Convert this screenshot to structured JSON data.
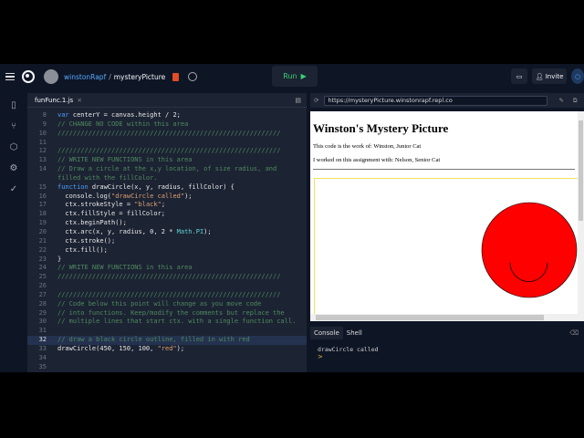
{
  "topbar": {
    "user": "winstonRapf",
    "separator": "/",
    "repl": "mysteryPicture",
    "run_label": "Run",
    "invite_label": "Invite"
  },
  "editor": {
    "tab": "funFunc.1.js",
    "close": "×",
    "lines": [
      {
        "n": "8",
        "t": [
          [
            "k",
            "var"
          ],
          [
            "p",
            " centerY = canvas.height / 2;"
          ]
        ]
      },
      {
        "n": "9",
        "t": [
          [
            "c",
            "// CHANGE NO CODE within this area"
          ]
        ]
      },
      {
        "n": "10",
        "t": [
          [
            "c",
            "//////////////////////////////////////////////////////////"
          ]
        ]
      },
      {
        "n": "11",
        "t": []
      },
      {
        "n": "12",
        "t": [
          [
            "c",
            "//////////////////////////////////////////////////////////"
          ]
        ]
      },
      {
        "n": "13",
        "t": [
          [
            "c",
            "// WRITE NEW FUNCTIONS in this area"
          ]
        ]
      },
      {
        "n": "14",
        "t": [
          [
            "c",
            "// Draw a circle at the x,y location, of size radius, and"
          ]
        ]
      },
      {
        "n": "",
        "t": [
          [
            "c",
            "filled with the fillColor."
          ]
        ]
      },
      {
        "n": "15",
        "t": [
          [
            "k",
            "function"
          ],
          [
            "p",
            " drawCircle(x, y, radius, fillColor) {"
          ]
        ]
      },
      {
        "n": "16",
        "t": [
          [
            "p",
            "  console.log("
          ],
          [
            "s",
            "\"drawCircle called\""
          ],
          [
            "p",
            ");"
          ]
        ]
      },
      {
        "n": "17",
        "t": [
          [
            "p",
            "  ctx.strokeStyle = "
          ],
          [
            "s",
            "\"black\""
          ],
          [
            "p",
            ";"
          ]
        ]
      },
      {
        "n": "18",
        "t": [
          [
            "p",
            "  ctx.fillStyle = fillColor;"
          ]
        ]
      },
      {
        "n": "19",
        "t": [
          [
            "p",
            "  ctx.beginPath();"
          ]
        ]
      },
      {
        "n": "20",
        "t": [
          [
            "p",
            "  ctx.arc(x, y, radius, 0, 2 * "
          ],
          [
            "m",
            "Math.PI"
          ],
          [
            "p",
            ");"
          ]
        ]
      },
      {
        "n": "21",
        "t": [
          [
            "p",
            "  ctx.stroke();"
          ]
        ]
      },
      {
        "n": "22",
        "t": [
          [
            "p",
            "  ctx.fill();"
          ]
        ]
      },
      {
        "n": "23",
        "t": [
          [
            "p",
            "}"
          ]
        ]
      },
      {
        "n": "24",
        "t": [
          [
            "c",
            "// WRITE NEW FUNCTIONS in this area"
          ]
        ]
      },
      {
        "n": "25",
        "t": [
          [
            "c",
            "//////////////////////////////////////////////////////////"
          ]
        ]
      },
      {
        "n": "26",
        "t": []
      },
      {
        "n": "27",
        "t": [
          [
            "c",
            "//////////////////////////////////////////////////////////"
          ]
        ]
      },
      {
        "n": "28",
        "t": [
          [
            "c",
            "// Code below this point will change as you move code"
          ]
        ]
      },
      {
        "n": "29",
        "t": [
          [
            "c",
            "// into functions. Keep/modify the comments but replace the"
          ]
        ]
      },
      {
        "n": "30",
        "t": [
          [
            "c",
            "// multiple lines that start ctx. with a single function call."
          ]
        ]
      },
      {
        "n": "31",
        "t": []
      },
      {
        "n": "32",
        "t": [
          [
            "c",
            "// draw a black circle outline, filled in with red"
          ]
        ],
        "hl": true
      },
      {
        "n": "33",
        "t": [
          [
            "p",
            "drawCircle(450, 150, 100, "
          ],
          [
            "s",
            "\"red\""
          ],
          [
            "p",
            ");"
          ]
        ]
      },
      {
        "n": "34",
        "t": []
      },
      {
        "n": "35",
        "t": []
      }
    ]
  },
  "webview": {
    "url": "https://mysteryPicture.winstonrapf.repl.co",
    "title": "Winston's Mystery Picture",
    "line1": "This code is the work of: Winston, Junior Cat",
    "line2": "I worked on this assignment with: Nelson, Senior Cat",
    "circle_fill": "#ff0000"
  },
  "console": {
    "tabs": [
      "Console",
      "Shell"
    ],
    "output": "drawCircle called",
    "prompt": ">"
  }
}
